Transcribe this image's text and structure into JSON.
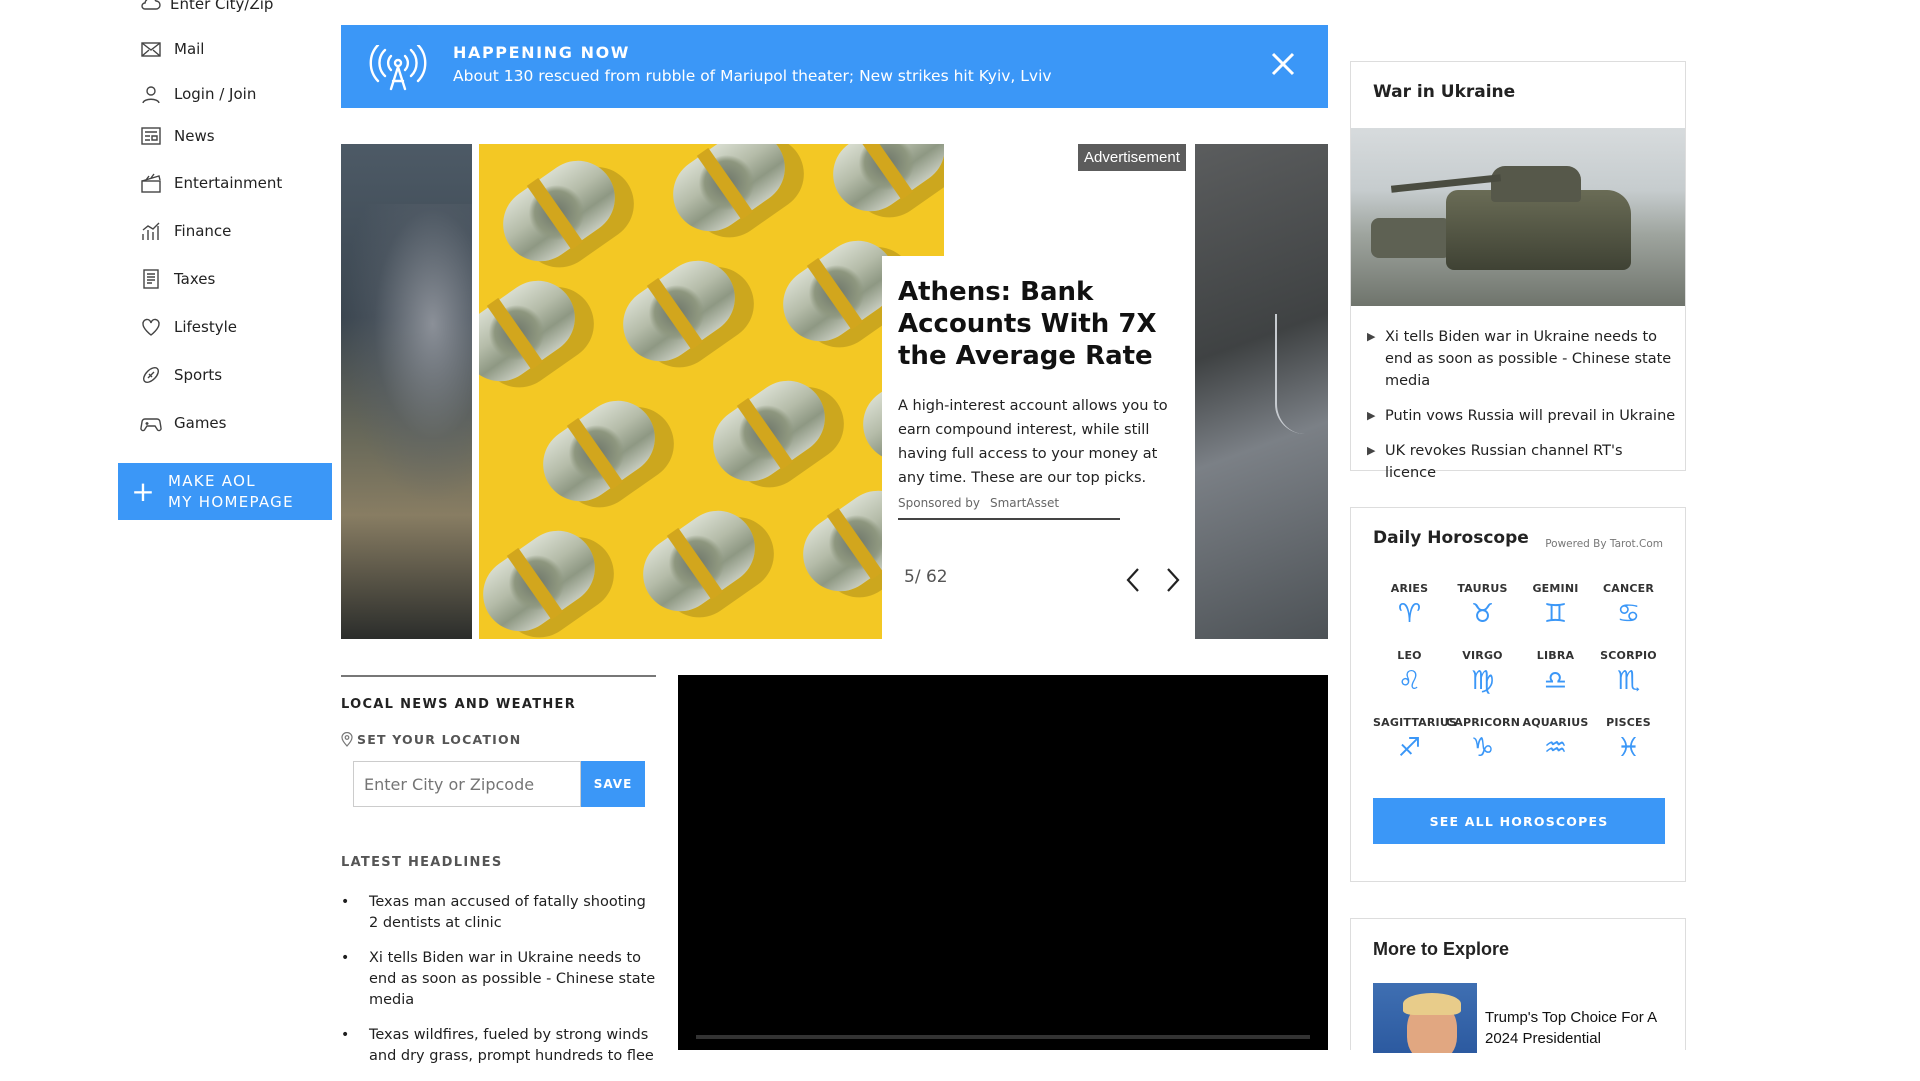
{
  "nav": {
    "location": "Enter City/Zip",
    "items": [
      {
        "label": "Mail",
        "icon": "mail-icon"
      },
      {
        "label": "Login / Join",
        "icon": "user-icon"
      },
      {
        "label": "News",
        "icon": "news-icon"
      },
      {
        "label": "Entertainment",
        "icon": "clapper-icon"
      },
      {
        "label": "Finance",
        "icon": "chart-icon"
      },
      {
        "label": "Taxes",
        "icon": "document-icon"
      },
      {
        "label": "Lifestyle",
        "icon": "heart-icon"
      },
      {
        "label": "Sports",
        "icon": "football-icon"
      },
      {
        "label": "Games",
        "icon": "gamepad-icon"
      }
    ],
    "homepage_line1": "MAKE AOL",
    "homepage_line2": "MY HOMEPAGE"
  },
  "banner": {
    "kicker": "HAPPENING NOW",
    "headline": "About 130 rescued from rubble of Mariupol theater; New strikes hit Kyiv, Lviv"
  },
  "carousel": {
    "ad_label": "Advertisement",
    "title": "Athens: Bank Accounts With 7X the Average Rate",
    "body": "A high-interest account allows you to earn compound interest, while still having full access to your money at any time. These are our top picks.",
    "sponsored_by": "Sponsored by",
    "sponsor": "SmartAsset",
    "counter": "5/ 62"
  },
  "local": {
    "heading": "LOCAL NEWS AND WEATHER",
    "set_location": "SET YOUR LOCATION",
    "placeholder": "Enter City or Zipcode",
    "save": "SAVE",
    "latest_heading": "LATEST HEADLINES",
    "headlines": [
      "Texas man accused of fatally shooting 2 dentists at clinic",
      "Xi tells Biden war in Ukraine needs to end as soon as possible - Chinese state media",
      "Texas wildfires, fueled by strong winds and dry grass, prompt hundreds to flee"
    ]
  },
  "war": {
    "title": "War in Ukraine",
    "items": [
      "Xi tells Biden war in Ukraine needs to end as soon as possible - Chinese state media",
      "Putin vows Russia will prevail in Ukraine",
      "UK revokes Russian channel RT's licence"
    ]
  },
  "horoscope": {
    "title": "Daily Horoscope",
    "powered": "Powered By Tarot.Com",
    "signs": [
      {
        "name": "ARIES",
        "glyph": "♈︎"
      },
      {
        "name": "TAURUS",
        "glyph": "♉︎"
      },
      {
        "name": "GEMINI",
        "glyph": "♊︎"
      },
      {
        "name": "CANCER",
        "glyph": "♋︎"
      },
      {
        "name": "LEO",
        "glyph": "♌︎"
      },
      {
        "name": "VIRGO",
        "glyph": "♍︎"
      },
      {
        "name": "LIBRA",
        "glyph": "♎︎"
      },
      {
        "name": "SCORPIO",
        "glyph": "♏︎"
      },
      {
        "name": "SAGITTARIUS",
        "glyph": "♐︎"
      },
      {
        "name": "CAPRICORN",
        "glyph": "♑︎"
      },
      {
        "name": "AQUARIUS",
        "glyph": "♒︎"
      },
      {
        "name": "PISCES",
        "glyph": "♓︎"
      }
    ],
    "button": "SEE ALL HOROSCOPES"
  },
  "explore": {
    "title": "More to Explore",
    "item": "Trump's Top Choice For A 2024 Presidential"
  },
  "colors": {
    "accent": "#3b97f7",
    "ad_badge": "#5c5c5c"
  }
}
